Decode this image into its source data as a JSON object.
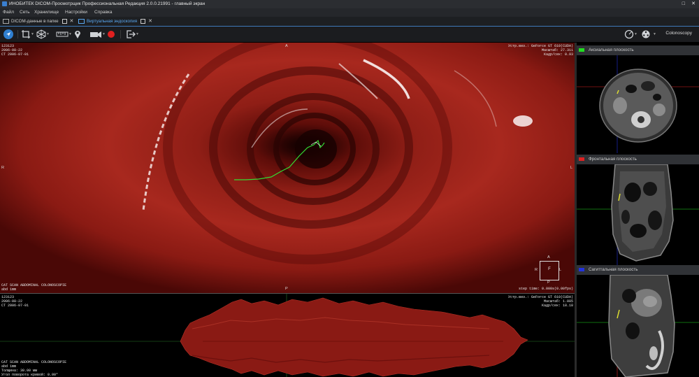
{
  "window": {
    "title": "ИНОБИТЕК DICOM-Просмотрщик Профессиональная Редакция 2.0.0.21991 - главный экран"
  },
  "menu": [
    "Файл",
    "Сеть",
    "Хранилище",
    "Настройки",
    "Справка"
  ],
  "tabs": [
    {
      "label": "DICOM-данные в папке",
      "active": false
    },
    {
      "label": "Виртуальная эндоскопия",
      "active": true
    }
  ],
  "toolbar": {
    "mode_label": "Colonoscopy"
  },
  "main_view": {
    "top_left": "123123\n2006-08-22\nCT 2006-07-01",
    "top_right": "Устр.виз.: GeForce GT 610(CUDA)\nМасштаб: 27.311\nКадр/сек: 0.93",
    "bottom_left": "CAT SCAN ABDOMINAL COLONOSCOPIE\nabd 1mm",
    "bottom_right": "step time: 0.000s(0.00fps)",
    "orient": {
      "top": "A",
      "bottom": "P",
      "left": "R",
      "right": "L"
    },
    "cube": {
      "top": "A",
      "bottom": "P",
      "left": "R",
      "right": "L",
      "center": "F"
    }
  },
  "bottom_view": {
    "top_left": "123123\n2006-08-22\nCT 2006-07-01",
    "top_right": "Устр.виз.: GeForce GT 610(CUDA)\nМасштаб: 1.085\nКадр/сек: 18.18",
    "bottom_left": "CAT SCAN ABDOMINAL COLONOSCOPIE\nabd 1mm\nТолщина: 30.00 мм\nУгол поворота кривой: 0.00°"
  },
  "planes": [
    {
      "label": "Аксиальная плоскость",
      "color": "#22dd22"
    },
    {
      "label": "Фронтальная плоскость",
      "color": "#dd2222"
    },
    {
      "label": "Сагиттальная плоскость",
      "color": "#2233dd"
    }
  ],
  "colors": {
    "accent": "#2f7fd0",
    "path": "#33dd33",
    "tissue": "#9a1a14"
  }
}
